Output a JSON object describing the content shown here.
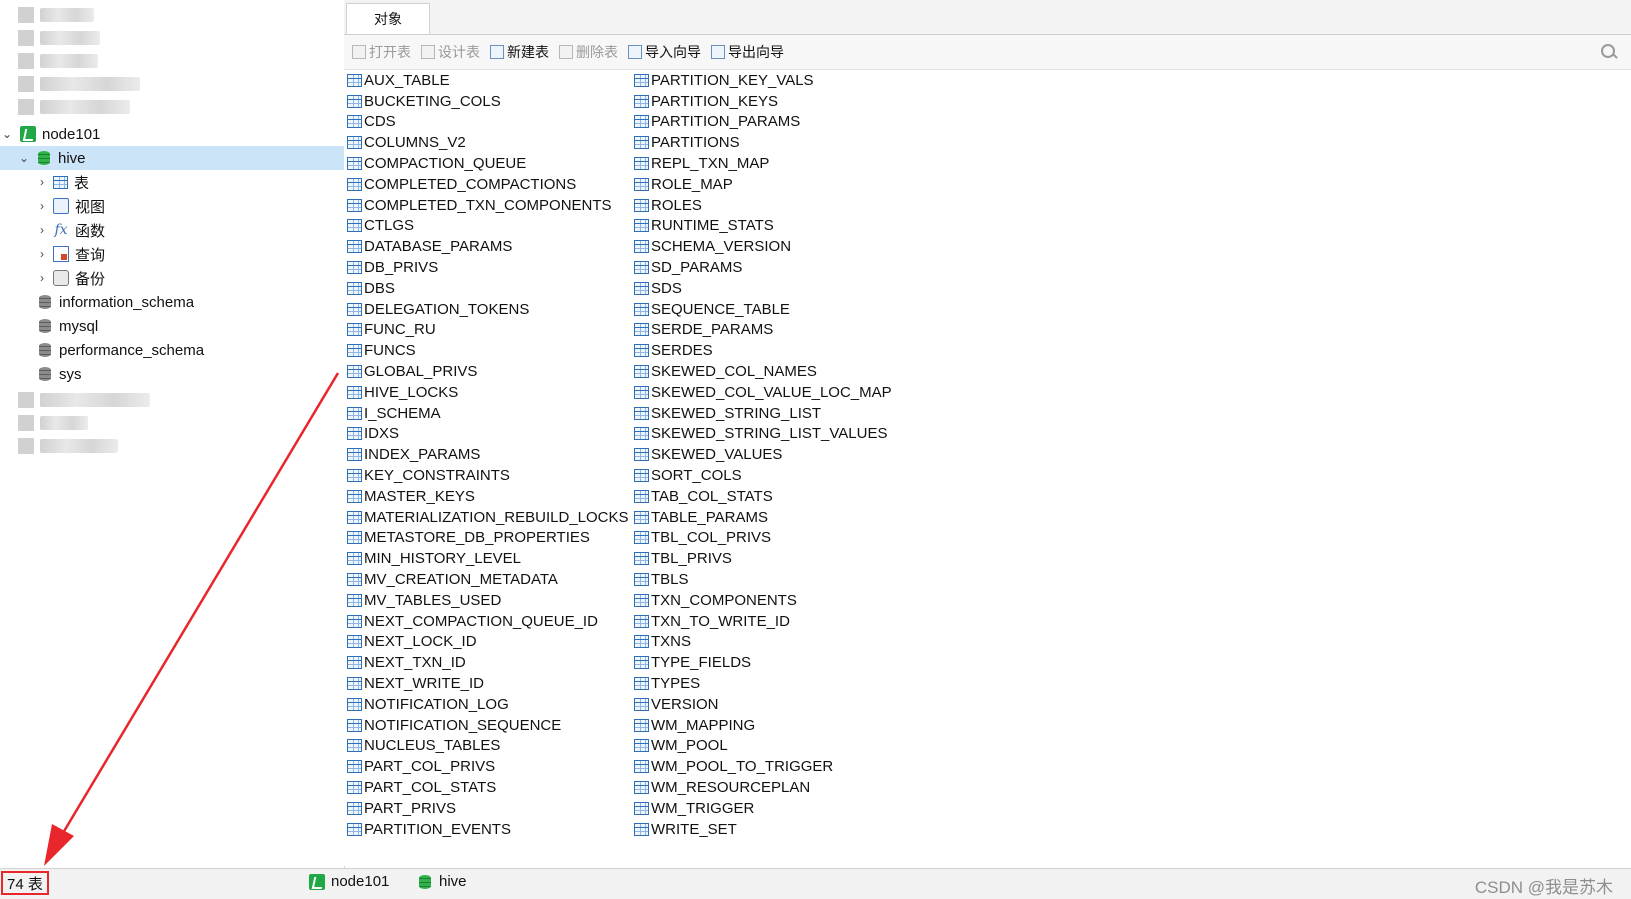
{
  "sidebar": {
    "connection": "node101",
    "database": "hive",
    "children": [
      "表",
      "视图",
      "函数",
      "查询",
      "备份"
    ],
    "other_databases": [
      "information_schema",
      "mysql",
      "performance_schema",
      "sys"
    ]
  },
  "tabs": {
    "objects": "对象"
  },
  "toolbar": {
    "open_table": "打开表",
    "design_table": "设计表",
    "new_table": "新建表",
    "delete_table": "删除表",
    "import_wizard": "导入向导",
    "export_wizard": "导出向导"
  },
  "tables_col1": [
    "AUX_TABLE",
    "BUCKETING_COLS",
    "CDS",
    "COLUMNS_V2",
    "COMPACTION_QUEUE",
    "COMPLETED_COMPACTIONS",
    "COMPLETED_TXN_COMPONENTS",
    "CTLGS",
    "DATABASE_PARAMS",
    "DB_PRIVS",
    "DBS",
    "DELEGATION_TOKENS",
    "FUNC_RU",
    "FUNCS",
    "GLOBAL_PRIVS",
    "HIVE_LOCKS",
    "I_SCHEMA",
    "IDXS",
    "INDEX_PARAMS",
    "KEY_CONSTRAINTS",
    "MASTER_KEYS",
    "MATERIALIZATION_REBUILD_LOCKS",
    "METASTORE_DB_PROPERTIES",
    "MIN_HISTORY_LEVEL",
    "MV_CREATION_METADATA",
    "MV_TABLES_USED",
    "NEXT_COMPACTION_QUEUE_ID",
    "NEXT_LOCK_ID",
    "NEXT_TXN_ID",
    "NEXT_WRITE_ID",
    "NOTIFICATION_LOG",
    "NOTIFICATION_SEQUENCE",
    "NUCLEUS_TABLES",
    "PART_COL_PRIVS",
    "PART_COL_STATS",
    "PART_PRIVS",
    "PARTITION_EVENTS"
  ],
  "tables_col2": [
    "PARTITION_KEY_VALS",
    "PARTITION_KEYS",
    "PARTITION_PARAMS",
    "PARTITIONS",
    "REPL_TXN_MAP",
    "ROLE_MAP",
    "ROLES",
    "RUNTIME_STATS",
    "SCHEMA_VERSION",
    "SD_PARAMS",
    "SDS",
    "SEQUENCE_TABLE",
    "SERDE_PARAMS",
    "SERDES",
    "SKEWED_COL_NAMES",
    "SKEWED_COL_VALUE_LOC_MAP",
    "SKEWED_STRING_LIST",
    "SKEWED_STRING_LIST_VALUES",
    "SKEWED_VALUES",
    "SORT_COLS",
    "TAB_COL_STATS",
    "TABLE_PARAMS",
    "TBL_COL_PRIVS",
    "TBL_PRIVS",
    "TBLS",
    "TXN_COMPONENTS",
    "TXN_TO_WRITE_ID",
    "TXNS",
    "TYPE_FIELDS",
    "TYPES",
    "VERSION",
    "WM_MAPPING",
    "WM_POOL",
    "WM_POOL_TO_TRIGGER",
    "WM_RESOURCEPLAN",
    "WM_TRIGGER",
    "WRITE_SET"
  ],
  "status": {
    "count": "74 表",
    "connection": "node101",
    "database": "hive",
    "watermark": "CSDN @我是苏木"
  },
  "colors": {
    "annotation": "#e8262b",
    "selection": "#cce4f7"
  }
}
